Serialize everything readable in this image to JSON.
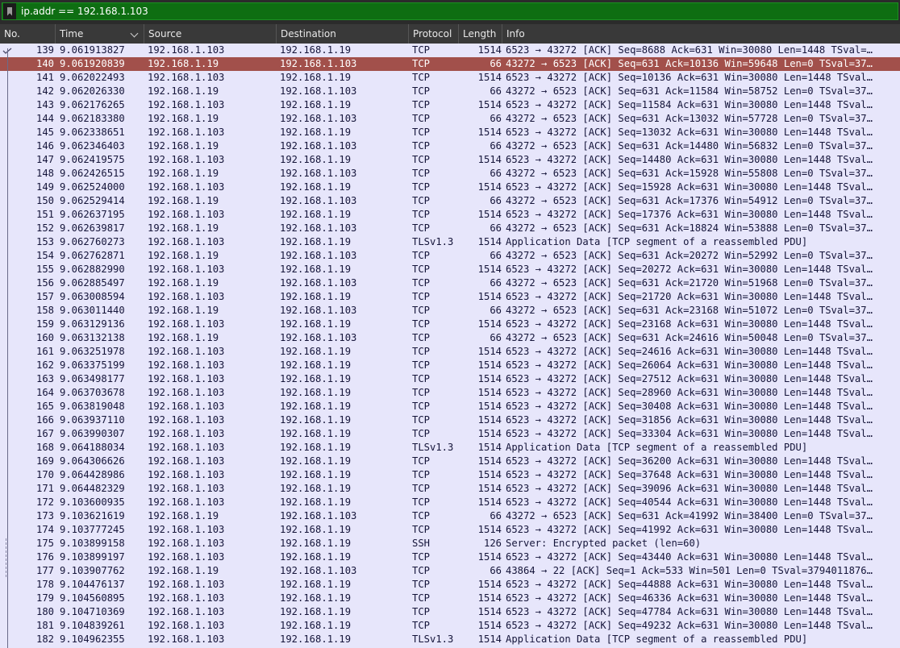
{
  "filter": {
    "value": "ip.addr == 192.168.1.103",
    "bookmark_icon": "bookmark-icon",
    "accent_color": "#0e6e12"
  },
  "columns": [
    "No.",
    "Time",
    "Source",
    "Destination",
    "Protocol",
    "Length",
    "Info"
  ],
  "sort": {
    "column": "Time",
    "icon": "chevron-down-icon"
  },
  "selected_row_color": "#a2504b",
  "rows": [
    {
      "no": "139",
      "time": "9.061913827",
      "src": "192.168.1.103",
      "dst": "192.168.1.19",
      "proto": "TCP",
      "len": "1514",
      "info": "6523 → 43272 [ACK] Seq=8688 Ack=631 Win=30080 Len=1448 TSval=…"
    },
    {
      "no": "140",
      "time": "9.061920839",
      "src": "192.168.1.19",
      "dst": "192.168.1.103",
      "proto": "TCP",
      "len": "66",
      "info": "43272 → 6523 [ACK] Seq=631 Ack=10136 Win=59648 Len=0 TSval=37…",
      "selected": true
    },
    {
      "no": "141",
      "time": "9.062022493",
      "src": "192.168.1.103",
      "dst": "192.168.1.19",
      "proto": "TCP",
      "len": "1514",
      "info": "6523 → 43272 [ACK] Seq=10136 Ack=631 Win=30080 Len=1448 TSval…"
    },
    {
      "no": "142",
      "time": "9.062026330",
      "src": "192.168.1.19",
      "dst": "192.168.1.103",
      "proto": "TCP",
      "len": "66",
      "info": "43272 → 6523 [ACK] Seq=631 Ack=11584 Win=58752 Len=0 TSval=37…"
    },
    {
      "no": "143",
      "time": "9.062176265",
      "src": "192.168.1.103",
      "dst": "192.168.1.19",
      "proto": "TCP",
      "len": "1514",
      "info": "6523 → 43272 [ACK] Seq=11584 Ack=631 Win=30080 Len=1448 TSval…"
    },
    {
      "no": "144",
      "time": "9.062183380",
      "src": "192.168.1.19",
      "dst": "192.168.1.103",
      "proto": "TCP",
      "len": "66",
      "info": "43272 → 6523 [ACK] Seq=631 Ack=13032 Win=57728 Len=0 TSval=37…"
    },
    {
      "no": "145",
      "time": "9.062338651",
      "src": "192.168.1.103",
      "dst": "192.168.1.19",
      "proto": "TCP",
      "len": "1514",
      "info": "6523 → 43272 [ACK] Seq=13032 Ack=631 Win=30080 Len=1448 TSval…"
    },
    {
      "no": "146",
      "time": "9.062346403",
      "src": "192.168.1.19",
      "dst": "192.168.1.103",
      "proto": "TCP",
      "len": "66",
      "info": "43272 → 6523 [ACK] Seq=631 Ack=14480 Win=56832 Len=0 TSval=37…"
    },
    {
      "no": "147",
      "time": "9.062419575",
      "src": "192.168.1.103",
      "dst": "192.168.1.19",
      "proto": "TCP",
      "len": "1514",
      "info": "6523 → 43272 [ACK] Seq=14480 Ack=631 Win=30080 Len=1448 TSval…"
    },
    {
      "no": "148",
      "time": "9.062426515",
      "src": "192.168.1.19",
      "dst": "192.168.1.103",
      "proto": "TCP",
      "len": "66",
      "info": "43272 → 6523 [ACK] Seq=631 Ack=15928 Win=55808 Len=0 TSval=37…"
    },
    {
      "no": "149",
      "time": "9.062524000",
      "src": "192.168.1.103",
      "dst": "192.168.1.19",
      "proto": "TCP",
      "len": "1514",
      "info": "6523 → 43272 [ACK] Seq=15928 Ack=631 Win=30080 Len=1448 TSval…"
    },
    {
      "no": "150",
      "time": "9.062529414",
      "src": "192.168.1.19",
      "dst": "192.168.1.103",
      "proto": "TCP",
      "len": "66",
      "info": "43272 → 6523 [ACK] Seq=631 Ack=17376 Win=54912 Len=0 TSval=37…"
    },
    {
      "no": "151",
      "time": "9.062637195",
      "src": "192.168.1.103",
      "dst": "192.168.1.19",
      "proto": "TCP",
      "len": "1514",
      "info": "6523 → 43272 [ACK] Seq=17376 Ack=631 Win=30080 Len=1448 TSval…"
    },
    {
      "no": "152",
      "time": "9.062639817",
      "src": "192.168.1.19",
      "dst": "192.168.1.103",
      "proto": "TCP",
      "len": "66",
      "info": "43272 → 6523 [ACK] Seq=631 Ack=18824 Win=53888 Len=0 TSval=37…"
    },
    {
      "no": "153",
      "time": "9.062760273",
      "src": "192.168.1.103",
      "dst": "192.168.1.19",
      "proto": "TLSv1.3",
      "len": "1514",
      "info": "Application Data [TCP segment of a reassembled PDU]"
    },
    {
      "no": "154",
      "time": "9.062762871",
      "src": "192.168.1.19",
      "dst": "192.168.1.103",
      "proto": "TCP",
      "len": "66",
      "info": "43272 → 6523 [ACK] Seq=631 Ack=20272 Win=52992 Len=0 TSval=37…"
    },
    {
      "no": "155",
      "time": "9.062882990",
      "src": "192.168.1.103",
      "dst": "192.168.1.19",
      "proto": "TCP",
      "len": "1514",
      "info": "6523 → 43272 [ACK] Seq=20272 Ack=631 Win=30080 Len=1448 TSval…"
    },
    {
      "no": "156",
      "time": "9.062885497",
      "src": "192.168.1.19",
      "dst": "192.168.1.103",
      "proto": "TCP",
      "len": "66",
      "info": "43272 → 6523 [ACK] Seq=631 Ack=21720 Win=51968 Len=0 TSval=37…"
    },
    {
      "no": "157",
      "time": "9.063008594",
      "src": "192.168.1.103",
      "dst": "192.168.1.19",
      "proto": "TCP",
      "len": "1514",
      "info": "6523 → 43272 [ACK] Seq=21720 Ack=631 Win=30080 Len=1448 TSval…"
    },
    {
      "no": "158",
      "time": "9.063011440",
      "src": "192.168.1.19",
      "dst": "192.168.1.103",
      "proto": "TCP",
      "len": "66",
      "info": "43272 → 6523 [ACK] Seq=631 Ack=23168 Win=51072 Len=0 TSval=37…"
    },
    {
      "no": "159",
      "time": "9.063129136",
      "src": "192.168.1.103",
      "dst": "192.168.1.19",
      "proto": "TCP",
      "len": "1514",
      "info": "6523 → 43272 [ACK] Seq=23168 Ack=631 Win=30080 Len=1448 TSval…"
    },
    {
      "no": "160",
      "time": "9.063132138",
      "src": "192.168.1.19",
      "dst": "192.168.1.103",
      "proto": "TCP",
      "len": "66",
      "info": "43272 → 6523 [ACK] Seq=631 Ack=24616 Win=50048 Len=0 TSval=37…"
    },
    {
      "no": "161",
      "time": "9.063251978",
      "src": "192.168.1.103",
      "dst": "192.168.1.19",
      "proto": "TCP",
      "len": "1514",
      "info": "6523 → 43272 [ACK] Seq=24616 Ack=631 Win=30080 Len=1448 TSval…"
    },
    {
      "no": "162",
      "time": "9.063375199",
      "src": "192.168.1.103",
      "dst": "192.168.1.19",
      "proto": "TCP",
      "len": "1514",
      "info": "6523 → 43272 [ACK] Seq=26064 Ack=631 Win=30080 Len=1448 TSval…"
    },
    {
      "no": "163",
      "time": "9.063498177",
      "src": "192.168.1.103",
      "dst": "192.168.1.19",
      "proto": "TCP",
      "len": "1514",
      "info": "6523 → 43272 [ACK] Seq=27512 Ack=631 Win=30080 Len=1448 TSval…"
    },
    {
      "no": "164",
      "time": "9.063703678",
      "src": "192.168.1.103",
      "dst": "192.168.1.19",
      "proto": "TCP",
      "len": "1514",
      "info": "6523 → 43272 [ACK] Seq=28960 Ack=631 Win=30080 Len=1448 TSval…"
    },
    {
      "no": "165",
      "time": "9.063819048",
      "src": "192.168.1.103",
      "dst": "192.168.1.19",
      "proto": "TCP",
      "len": "1514",
      "info": "6523 → 43272 [ACK] Seq=30408 Ack=631 Win=30080 Len=1448 TSval…"
    },
    {
      "no": "166",
      "time": "9.063937110",
      "src": "192.168.1.103",
      "dst": "192.168.1.19",
      "proto": "TCP",
      "len": "1514",
      "info": "6523 → 43272 [ACK] Seq=31856 Ack=631 Win=30080 Len=1448 TSval…"
    },
    {
      "no": "167",
      "time": "9.063990307",
      "src": "192.168.1.103",
      "dst": "192.168.1.19",
      "proto": "TCP",
      "len": "1514",
      "info": "6523 → 43272 [ACK] Seq=33304 Ack=631 Win=30080 Len=1448 TSval…"
    },
    {
      "no": "168",
      "time": "9.064188034",
      "src": "192.168.1.103",
      "dst": "192.168.1.19",
      "proto": "TLSv1.3",
      "len": "1514",
      "info": "Application Data [TCP segment of a reassembled PDU]"
    },
    {
      "no": "169",
      "time": "9.064306626",
      "src": "192.168.1.103",
      "dst": "192.168.1.19",
      "proto": "TCP",
      "len": "1514",
      "info": "6523 → 43272 [ACK] Seq=36200 Ack=631 Win=30080 Len=1448 TSval…"
    },
    {
      "no": "170",
      "time": "9.064428986",
      "src": "192.168.1.103",
      "dst": "192.168.1.19",
      "proto": "TCP",
      "len": "1514",
      "info": "6523 → 43272 [ACK] Seq=37648 Ack=631 Win=30080 Len=1448 TSval…"
    },
    {
      "no": "171",
      "time": "9.064482329",
      "src": "192.168.1.103",
      "dst": "192.168.1.19",
      "proto": "TCP",
      "len": "1514",
      "info": "6523 → 43272 [ACK] Seq=39096 Ack=631 Win=30080 Len=1448 TSval…"
    },
    {
      "no": "172",
      "time": "9.103600935",
      "src": "192.168.1.103",
      "dst": "192.168.1.19",
      "proto": "TCP",
      "len": "1514",
      "info": "6523 → 43272 [ACK] Seq=40544 Ack=631 Win=30080 Len=1448 TSval…"
    },
    {
      "no": "173",
      "time": "9.103621619",
      "src": "192.168.1.19",
      "dst": "192.168.1.103",
      "proto": "TCP",
      "len": "66",
      "info": "43272 → 6523 [ACK] Seq=631 Ack=41992 Win=38400 Len=0 TSval=37…"
    },
    {
      "no": "174",
      "time": "9.103777245",
      "src": "192.168.1.103",
      "dst": "192.168.1.19",
      "proto": "TCP",
      "len": "1514",
      "info": "6523 → 43272 [ACK] Seq=41992 Ack=631 Win=30080 Len=1448 TSval…"
    },
    {
      "no": "175",
      "time": "9.103899158",
      "src": "192.168.1.103",
      "dst": "192.168.1.19",
      "proto": "SSH",
      "len": "126",
      "info": "Server: Encrypted packet (len=60)"
    },
    {
      "no": "176",
      "time": "9.103899197",
      "src": "192.168.1.103",
      "dst": "192.168.1.19",
      "proto": "TCP",
      "len": "1514",
      "info": "6523 → 43272 [ACK] Seq=43440 Ack=631 Win=30080 Len=1448 TSval…"
    },
    {
      "no": "177",
      "time": "9.103907762",
      "src": "192.168.1.19",
      "dst": "192.168.1.103",
      "proto": "TCP",
      "len": "66",
      "info": "43864 → 22 [ACK] Seq=1 Ack=533 Win=501 Len=0 TSval=3794011876…"
    },
    {
      "no": "178",
      "time": "9.104476137",
      "src": "192.168.1.103",
      "dst": "192.168.1.19",
      "proto": "TCP",
      "len": "1514",
      "info": "6523 → 43272 [ACK] Seq=44888 Ack=631 Win=30080 Len=1448 TSval…"
    },
    {
      "no": "179",
      "time": "9.104560895",
      "src": "192.168.1.103",
      "dst": "192.168.1.19",
      "proto": "TCP",
      "len": "1514",
      "info": "6523 → 43272 [ACK] Seq=46336 Ack=631 Win=30080 Len=1448 TSval…"
    },
    {
      "no": "180",
      "time": "9.104710369",
      "src": "192.168.1.103",
      "dst": "192.168.1.19",
      "proto": "TCP",
      "len": "1514",
      "info": "6523 → 43272 [ACK] Seq=47784 Ack=631 Win=30080 Len=1448 TSval…"
    },
    {
      "no": "181",
      "time": "9.104839261",
      "src": "192.168.1.103",
      "dst": "192.168.1.19",
      "proto": "TCP",
      "len": "1514",
      "info": "6523 → 43272 [ACK] Seq=49232 Ack=631 Win=30080 Len=1448 TSval…"
    },
    {
      "no": "182",
      "time": "9.104962355",
      "src": "192.168.1.103",
      "dst": "192.168.1.19",
      "proto": "TLSv1.3",
      "len": "1514",
      "info": "Application Data [TCP segment of a reassembled PDU]"
    }
  ]
}
